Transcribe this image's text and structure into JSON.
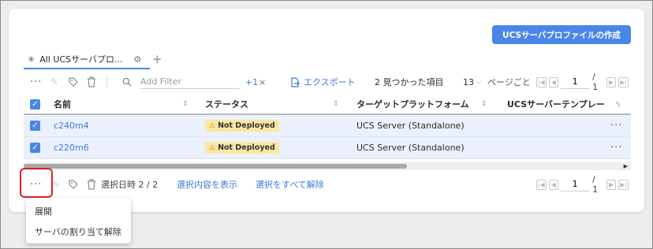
{
  "create_button": "UCSサーバプロファイルの作成",
  "tab": {
    "label": "All UCSサーバプロ...",
    "add": "+"
  },
  "toolbar": {
    "filter_placeholder": "Add Filter",
    "filter_count": "+1",
    "filter_clear": "×",
    "export_label": "エクスポート",
    "found_text": "2 見つかった項目",
    "per_page": "13",
    "per_page_suffix": "ページごと",
    "page": "1",
    "page_total": "/ 1"
  },
  "table": {
    "columns": [
      "名前",
      "ステータス",
      "ターゲットプラットフォーム",
      "UCSサーバーテンプレー"
    ],
    "rows": [
      {
        "name": "c240m4",
        "status": "Not Deployed",
        "platform": "UCS Server (Standalone)"
      },
      {
        "name": "c220m6",
        "status": "Not Deployed",
        "platform": "UCS Server (Standalone)"
      }
    ]
  },
  "bottom": {
    "selected_label": "選択日時 2 / 2",
    "show_selection": "選択内容を表示",
    "clear_selection": "選択をすべて解除",
    "page": "1",
    "page_total": "/ 1"
  },
  "menu": {
    "items": [
      "展開",
      "サーバの割り当て解除"
    ]
  },
  "colors": {
    "accent": "#4a86e8",
    "badge": "#fbe7a4",
    "highlight": "#e02020"
  }
}
